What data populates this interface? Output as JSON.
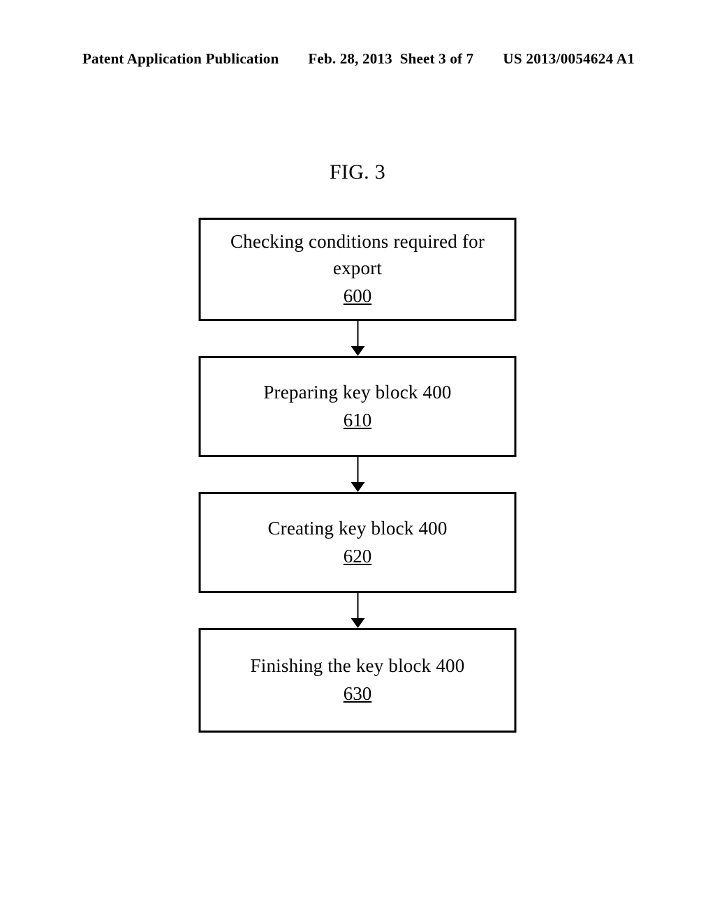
{
  "header": {
    "publication_label": "Patent Application Publication",
    "date": "Feb. 28, 2013",
    "sheet": "Sheet 3 of 7",
    "patent_number": "US 2013/0054624 A1"
  },
  "figure": {
    "label": "FIG. 3"
  },
  "flowchart": {
    "steps": [
      {
        "text": "Checking conditions required for export",
        "ref": "600"
      },
      {
        "text": "Preparing key block 400",
        "ref": "610"
      },
      {
        "text": "Creating key block 400",
        "ref": "620"
      },
      {
        "text": "Finishing the key block 400",
        "ref": "630"
      }
    ]
  }
}
